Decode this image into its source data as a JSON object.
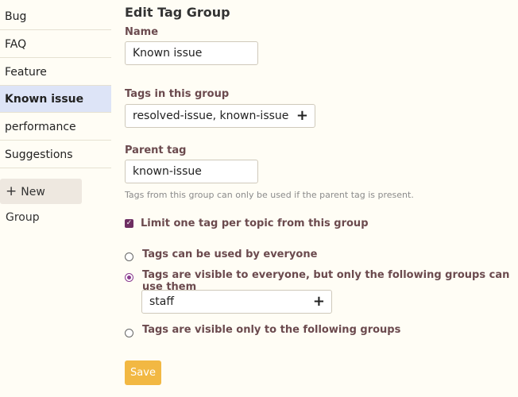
{
  "sidebar": {
    "items": [
      {
        "label": "Bug",
        "active": false
      },
      {
        "label": "FAQ",
        "active": false
      },
      {
        "label": "Feature",
        "active": false
      },
      {
        "label": "Known issue",
        "active": true
      },
      {
        "label": "performance",
        "active": false
      },
      {
        "label": "Suggestions",
        "active": false
      }
    ],
    "new_group_label": "New Group",
    "new_group_icon": "plus-icon"
  },
  "form": {
    "title": "Edit Tag Group",
    "name_label": "Name",
    "name_value": "Known issue",
    "tags_label": "Tags in this group",
    "tags_value": "resolved-issue, known-issue",
    "parent_label": "Parent tag",
    "parent_value": "known-issue",
    "parent_help": "Tags from this group can only be used if the parent tag is present.",
    "limit_one_label": "Limit one tag per topic from this group",
    "limit_one_checked": true,
    "visibility_options": [
      "Tags can be used by everyone",
      "Tags are visible to everyone, but only the following groups can use them",
      "Tags are visible only to the following groups"
    ],
    "visibility_selected": 1,
    "groups_value": "staff",
    "save_label": "Save"
  },
  "colors": {
    "active_nav_bg": "#dde4f7",
    "checkbox": "#6e2e62",
    "save_button": "#f2b843",
    "label_text": "#6b4a4e"
  }
}
